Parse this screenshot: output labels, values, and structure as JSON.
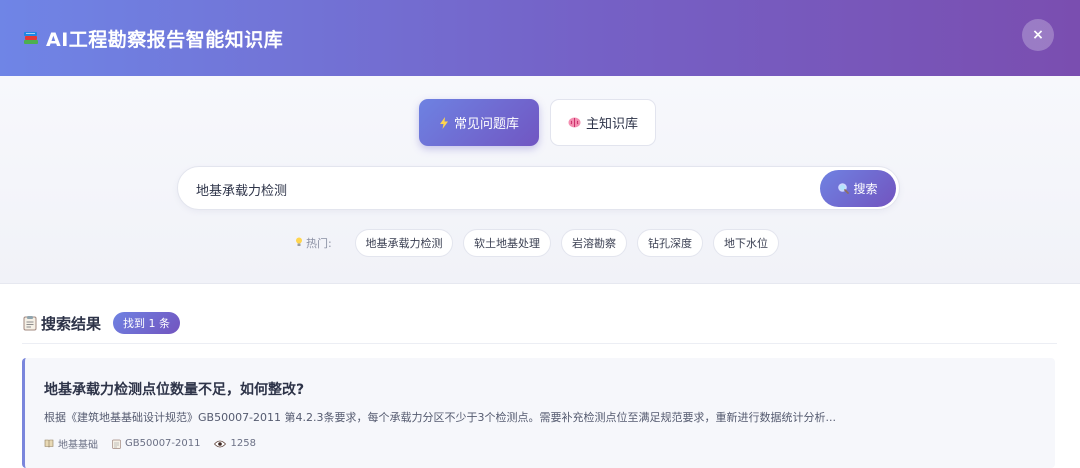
{
  "header": {
    "title": "AI工程勘察报告智能知识库",
    "logo_icon": "books-icon",
    "close_label": "×"
  },
  "tabs": [
    {
      "label": "常见问题库",
      "icon": "lightning-icon",
      "active": true
    },
    {
      "label": "主知识库",
      "icon": "brain-icon",
      "active": false
    }
  ],
  "search": {
    "value": "地基承载力检测",
    "placeholder": "",
    "button_label": "搜索",
    "button_icon": "magnifier-icon"
  },
  "hot": {
    "label": "热门:",
    "icon": "lightbulb-icon",
    "items": [
      "地基承载力检测",
      "软土地基处理",
      "岩溶勘察",
      "钻孔深度",
      "地下水位"
    ]
  },
  "results": {
    "title": "搜索结果",
    "icon": "clipboard-icon",
    "count_label": "找到 1 条",
    "items": [
      {
        "title": "地基承载力检测点位数量不足，如何整改?",
        "description": "根据《建筑地基基础设计规范》GB50007-2011 第4.2.3条要求，每个承载力分区不少于3个检测点。需要补充检测点位至满足规范要求，重新进行数据统计分析...",
        "category": "地基基础",
        "standard": "GB50007-2011",
        "views": "1258"
      }
    ]
  },
  "colors": {
    "header_start": "#6f85e6",
    "header_end": "#7a4eb0",
    "accent": "#7254bf",
    "card_border": "#7a86dc"
  }
}
